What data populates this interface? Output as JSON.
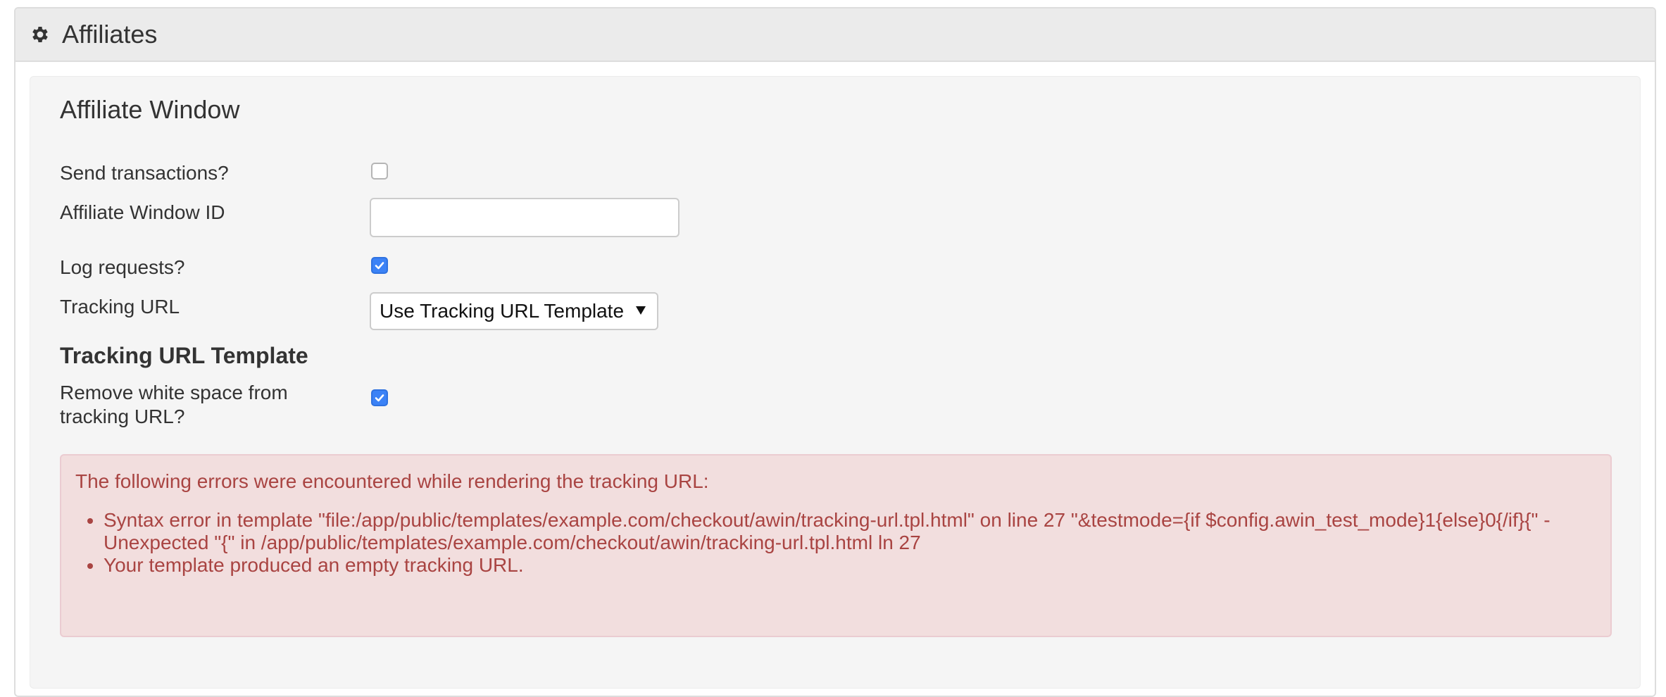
{
  "panel": {
    "title": "Affiliates",
    "icon": "gear-icon"
  },
  "section": {
    "title": "Affiliate Window",
    "fields": {
      "send_transactions": {
        "label": "Send transactions?",
        "checked": false
      },
      "affiliate_window_id": {
        "label": "Affiliate Window ID",
        "value": ""
      },
      "log_requests": {
        "label": "Log requests?",
        "checked": true
      },
      "tracking_url": {
        "label": "Tracking URL",
        "selected": "Use Tracking URL Template"
      }
    }
  },
  "template_section": {
    "title": "Tracking URL Template",
    "remove_whitespace": {
      "label_line1": "Remove white space from",
      "label_line2": "tracking URL?",
      "checked": true
    }
  },
  "error_alert": {
    "intro": "The following errors were encountered while rendering the tracking URL:",
    "errors": [
      {
        "line1": "Syntax error in template \"file:/app/public/templates/example.com/checkout/awin/tracking-url.tpl.html\" on line 27 \"&testmode={if $config.awin_test_mode}1{else}0{/if}{\" -",
        "line2": "Unexpected \"{\" in /app/public/templates/example.com/checkout/awin/tracking-url.tpl.html ln 27"
      },
      {
        "line1": "Your template produced an empty tracking URL."
      }
    ]
  },
  "colors": {
    "alert_text": "#a94442",
    "alert_bg": "#f2dede",
    "checkbox_accent": "#3b82f6"
  }
}
